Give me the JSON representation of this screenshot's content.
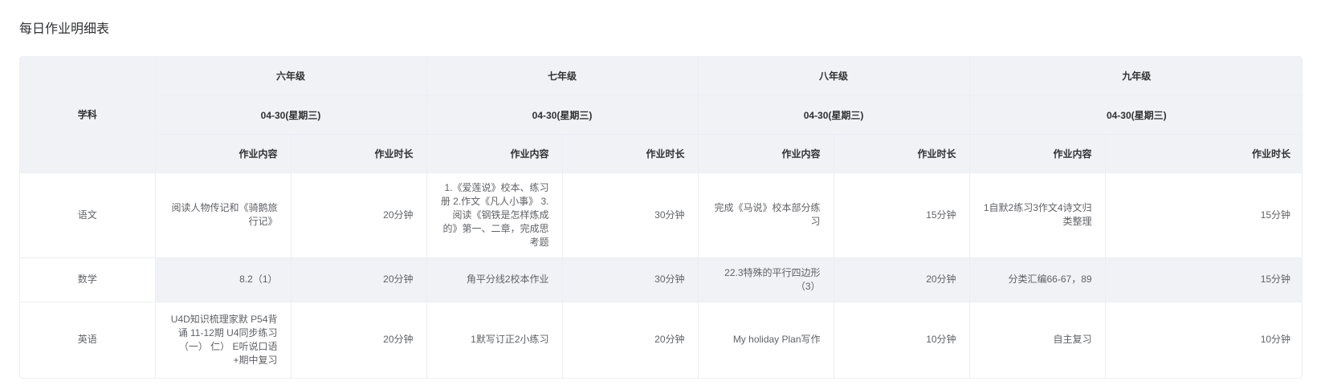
{
  "page": {
    "title": "每日作业明细表"
  },
  "table": {
    "subject_header": "学科",
    "content_header": "作业内容",
    "duration_header": "作业时长",
    "grades": [
      {
        "name": "六年级",
        "date": "04-30(星期三)"
      },
      {
        "name": "七年级",
        "date": "04-30(星期三)"
      },
      {
        "name": "八年级",
        "date": "04-30(星期三)"
      },
      {
        "name": "九年级",
        "date": "04-30(星期三)"
      }
    ],
    "rows": [
      {
        "subject": "语文",
        "cells": [
          {
            "content": "阅读人物传记和《骑鹅旅行记》",
            "duration": "20分钟"
          },
          {
            "content": "1.《爱莲说》校本、练习册 2.作文《凡人小事》 3.阅读《钢铁是怎样炼成的》第一、二章，完成思考题",
            "duration": "30分钟"
          },
          {
            "content": "完成《马说》校本部分练习",
            "duration": "15分钟"
          },
          {
            "content": "1自默2练习3作文4诗文归类整理",
            "duration": "15分钟"
          }
        ]
      },
      {
        "subject": "数学",
        "cells": [
          {
            "content": "8.2（1）",
            "duration": "20分钟"
          },
          {
            "content": "角平分线2校本作业",
            "duration": "30分钟"
          },
          {
            "content": "22.3特殊的平行四边形（3）",
            "duration": "20分钟"
          },
          {
            "content": "分类汇编66-67，89",
            "duration": "15分钟"
          }
        ]
      },
      {
        "subject": "英语",
        "cells": [
          {
            "content": "U4D知识梳理家默 P54背诵 11-12期 U4同步练习（一） 仁） E听说口语+期中复习",
            "duration": "20分钟"
          },
          {
            "content": "1默写订正2小练习",
            "duration": "20分钟"
          },
          {
            "content": "My holiday Plan写作",
            "duration": "10分钟"
          },
          {
            "content": "自主复习",
            "duration": "10分钟"
          }
        ]
      }
    ]
  }
}
